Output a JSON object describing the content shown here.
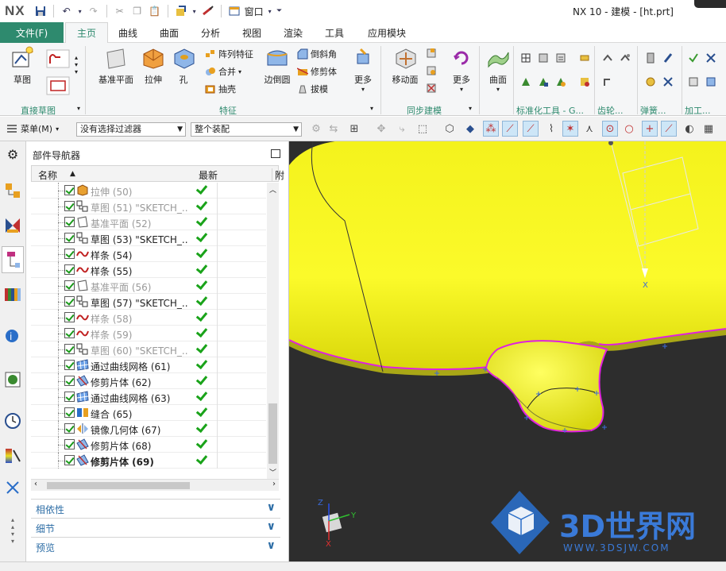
{
  "app": {
    "logo": "NX",
    "title": "NX 10 - 建模 - [ht.prt]"
  },
  "quick_access": {
    "window_label": "窗口"
  },
  "tabs": [
    {
      "label": "文件(F)"
    },
    {
      "label": "主页"
    },
    {
      "label": "曲线"
    },
    {
      "label": "曲面"
    },
    {
      "label": "分析"
    },
    {
      "label": "视图"
    },
    {
      "label": "渲染"
    },
    {
      "label": "工具"
    },
    {
      "label": "应用模块"
    }
  ],
  "ribbon": {
    "sketch": "草图",
    "datum_plane": "基准平面",
    "extrude": "拉伸",
    "hole": "孔",
    "pattern_feature": "阵列特征",
    "unite": "合并",
    "shell": "抽壳",
    "edge_blend": "边倒圆",
    "chamfer": "倒斜角",
    "trim_body": "修剪体",
    "draft": "拔模",
    "more1": "更多",
    "move_face": "移动面",
    "more2": "更多",
    "surface": "曲面",
    "groups": {
      "direct_sketch": "直接草图",
      "feature": "特征",
      "sync_modeling": "同步建模",
      "std_tools": "标准化工具 - G...",
      "gear": "齿轮...",
      "spring": "弹簧...",
      "machining": "加工..."
    }
  },
  "toolbar": {
    "menu_label": "菜单(M)",
    "filter_value": "没有选择过滤器",
    "assembly_value": "整个装配"
  },
  "navigator": {
    "title": "部件导航器",
    "col_name": "名称",
    "col_latest": "最新",
    "col_extra": "附",
    "rows": [
      {
        "label": "拉伸 (50)",
        "style": "dim",
        "icon": "extrude-icon"
      },
      {
        "label": "草图 (51) \"SKETCH_...",
        "style": "dim",
        "icon": "sketch-icon"
      },
      {
        "label": "基准平面 (52)",
        "style": "dim",
        "icon": "datum-plane-icon"
      },
      {
        "label": "草图 (53) \"SKETCH_...",
        "style": "normal",
        "icon": "sketch-icon"
      },
      {
        "label": "样条 (54)",
        "style": "normal",
        "icon": "spline-icon"
      },
      {
        "label": "样条 (55)",
        "style": "normal",
        "icon": "spline-icon"
      },
      {
        "label": "基准平面 (56)",
        "style": "dim",
        "icon": "datum-plane-icon"
      },
      {
        "label": "草图 (57) \"SKETCH_...",
        "style": "normal",
        "icon": "sketch-icon"
      },
      {
        "label": "样条 (58)",
        "style": "dim",
        "icon": "spline-icon"
      },
      {
        "label": "样条 (59)",
        "style": "dim",
        "icon": "spline-icon"
      },
      {
        "label": "草图 (60) \"SKETCH_...",
        "style": "dim",
        "icon": "sketch-icon"
      },
      {
        "label": "通过曲线网格 (61)",
        "style": "normal",
        "icon": "mesh-surface-icon"
      },
      {
        "label": "修剪片体 (62)",
        "style": "normal",
        "icon": "trim-sheet-icon"
      },
      {
        "label": "通过曲线网格 (63)",
        "style": "normal",
        "icon": "mesh-surface-icon"
      },
      {
        "label": "缝合 (65)",
        "style": "normal",
        "icon": "sew-icon"
      },
      {
        "label": "镜像几何体 (67)",
        "style": "normal",
        "icon": "mirror-icon"
      },
      {
        "label": "修剪片体 (68)",
        "style": "normal",
        "icon": "trim-sheet-icon"
      },
      {
        "label": "修剪片体 (69)",
        "style": "bold",
        "icon": "trim-sheet-icon"
      }
    ],
    "sections": [
      "相依性",
      "细节",
      "预览"
    ]
  },
  "viewport": {
    "watermark_main": "3D世界网",
    "watermark_url": "WWW.3DSJW.COM",
    "axis_x": "X",
    "axis_y": "Y",
    "axis_z": "Z",
    "datum_x": "X"
  }
}
